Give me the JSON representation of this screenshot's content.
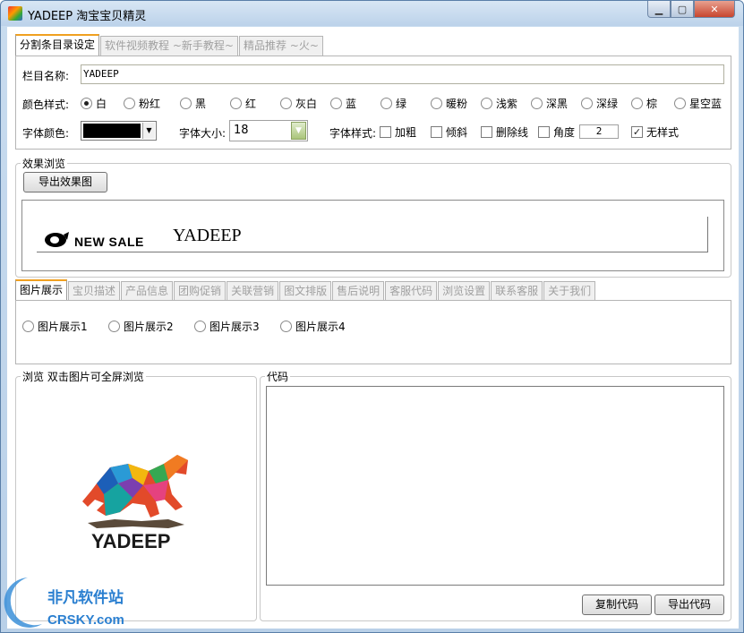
{
  "window": {
    "title": "YADEEP 淘宝宝贝精灵"
  },
  "top_tabs": [
    "分割条目录设定",
    "软件视频教程 ~新手教程~",
    "精品推荐 ~火~"
  ],
  "settings": {
    "name_label": "栏目名称:",
    "name_value": "YADEEP",
    "color_style_label": "颜色样式:",
    "color_styles": [
      "白",
      "粉红",
      "黑",
      "红",
      "灰白",
      "蓝",
      "绿",
      "暖粉",
      "浅紫",
      "深黑",
      "深绿",
      "棕",
      "星空蓝"
    ],
    "selected_style": "白",
    "font_color_label": "字体颜色:",
    "font_color": "#000000",
    "font_size_label": "字体大小:",
    "font_size": "18",
    "font_style_label": "字体样式:",
    "styles": [
      {
        "label": "加粗",
        "checked": false
      },
      {
        "label": "倾斜",
        "checked": false
      },
      {
        "label": "删除线",
        "checked": false
      },
      {
        "label": "角度",
        "checked": false
      }
    ],
    "angle_value": "2",
    "no_style": {
      "label": "无样式",
      "checked": true
    }
  },
  "preview": {
    "group_title": "效果浏览",
    "export_button": "导出效果图",
    "badge_text": "NEW SALE",
    "title_text": "YADEEP"
  },
  "lower_tabs": [
    "图片展示",
    "宝贝描述",
    "产品信息",
    "团购促销",
    "关联营销",
    "图文排版",
    "售后说明",
    "客服代码",
    "浏览设置",
    "联系客服",
    "关于我们"
  ],
  "image_options": [
    "图片展示1",
    "图片展示2",
    "图片展示3",
    "图片展示4"
  ],
  "browse": {
    "title": "浏览   双击图片可全屏浏览",
    "logo_text": "YADEEP"
  },
  "code": {
    "title": "代码",
    "copy_button": "复制代码",
    "export_button": "导出代码"
  },
  "watermark": {
    "cn": "非凡软件站",
    "en": "CRSKY.com"
  },
  "colors": {
    "active_tab_accent": "#f0a020",
    "watermark_blue": "#2a7fd0"
  }
}
